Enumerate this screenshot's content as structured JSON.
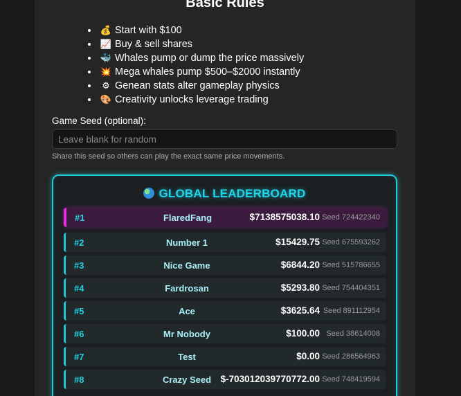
{
  "rules": {
    "title": "Basic Rules",
    "items": [
      {
        "icon": "💰",
        "icon_name": "money-bag-icon",
        "text": "Start with $100"
      },
      {
        "icon": "📈",
        "icon_name": "chart-up-icon",
        "text": "Buy & sell shares"
      },
      {
        "icon": "🐳",
        "icon_name": "whale-icon",
        "text": "Whales pump or dump the price massively"
      },
      {
        "icon": "💥",
        "icon_name": "explosion-icon",
        "text": "Mega whales pump $500–$2000 instantly"
      },
      {
        "icon": "⚙",
        "icon_name": "gear-icon",
        "text": "Genean stats alter gameplay physics"
      },
      {
        "icon": "🎨",
        "icon_name": "palette-icon",
        "text": "Creativity unlocks leverage trading"
      }
    ]
  },
  "seed": {
    "label": "Game Seed (optional):",
    "value": "",
    "placeholder": "Leave blank for random",
    "help": "Share this seed so others can play the exact same price movements."
  },
  "leaderboard": {
    "title": "GLOBAL LEADERBOARD",
    "icon": "globe-icon",
    "seed_prefix": "Seed",
    "highlight_color": "#e22ee0",
    "accent_color": "#22c8d8",
    "rows": [
      {
        "rank": "#1",
        "name": "FlaredFang",
        "money": "$7138575038.10",
        "seed": "Seed 724422340"
      },
      {
        "rank": "#2",
        "name": "Number 1",
        "money": "$15429.75",
        "seed": "Seed 675593262"
      },
      {
        "rank": "#3",
        "name": "Nice Game",
        "money": "$6844.20",
        "seed": "Seed 515786655"
      },
      {
        "rank": "#4",
        "name": "Fardrosan",
        "money": "$5293.80",
        "seed": "Seed 754404351"
      },
      {
        "rank": "#5",
        "name": "Ace",
        "money": "$3625.64",
        "seed": "Seed 891112954"
      },
      {
        "rank": "#6",
        "name": "Mr Nobody",
        "money": "$100.00",
        "seed": "Seed 38614008"
      },
      {
        "rank": "#7",
        "name": "Test",
        "money": "$0.00",
        "seed": "Seed 286564963"
      },
      {
        "rank": "#8",
        "name": "Crazy Seed",
        "money": "$-703012039770772.00",
        "seed": "Seed 748419594"
      }
    ]
  }
}
